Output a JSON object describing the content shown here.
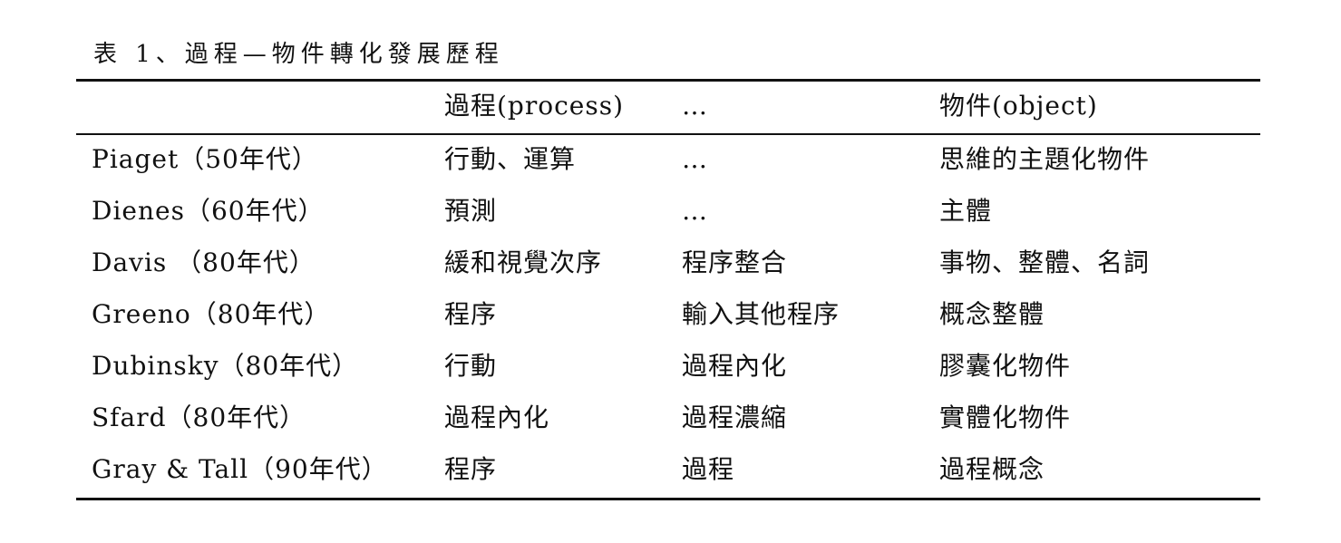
{
  "table": {
    "caption": "表 1、過程—物件轉化發展歷程",
    "header": [
      "",
      "過程(process)",
      "…",
      "物件(object)"
    ],
    "rows": [
      [
        "Piaget（50年代）",
        "行動、運算",
        "…",
        "思維的主題化物件"
      ],
      [
        "Dienes（60年代）",
        "預測",
        "…",
        "主體"
      ],
      [
        "Davis （80年代）",
        "緩和視覺次序",
        "程序整合",
        "事物、整體、名詞"
      ],
      [
        "Greeno（80年代）",
        "程序",
        "輸入其他程序",
        "概念整體"
      ],
      [
        "Dubinsky（80年代）",
        "行動",
        "過程內化",
        "膠囊化物件"
      ],
      [
        "Sfard（80年代）",
        "過程內化",
        "過程濃縮",
        "實體化物件"
      ],
      [
        "Gray & Tall（90年代）",
        "程序",
        "過程",
        "過程概念"
      ]
    ]
  }
}
